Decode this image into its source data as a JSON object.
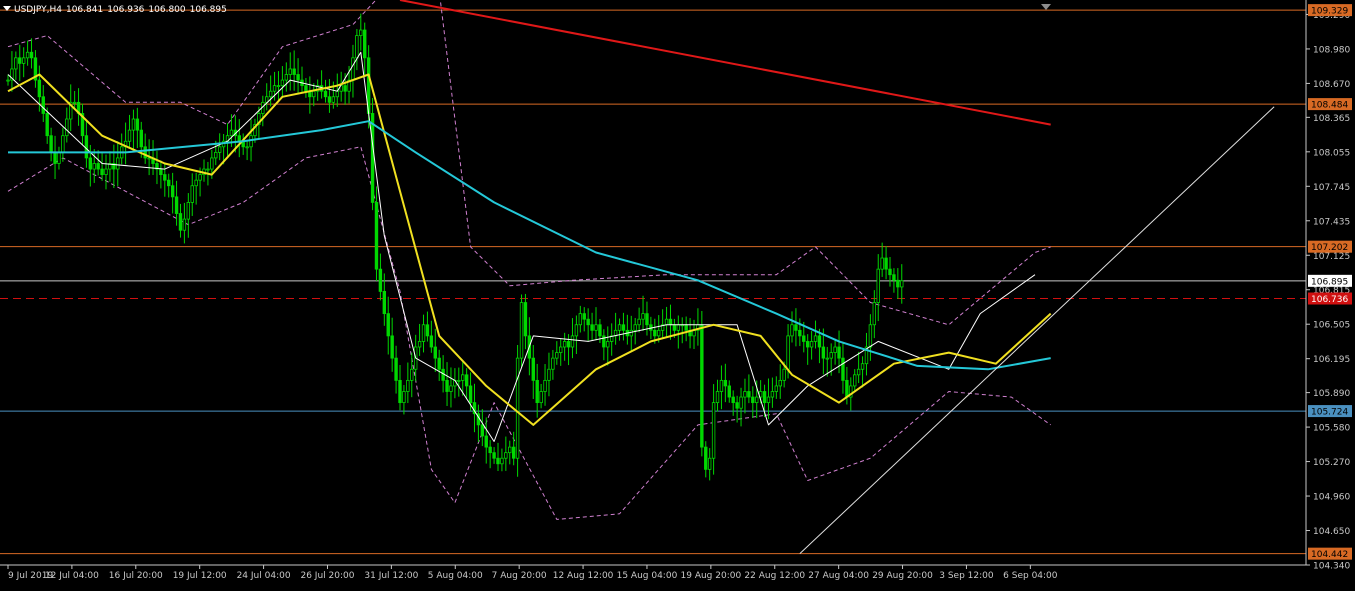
{
  "header": {
    "symbol": "USDJPY,H4",
    "open": "106.841",
    "high": "106.936",
    "low": "106.800",
    "close": "106.895"
  },
  "colors": {
    "background": "#000000",
    "bull_bar": "#00d800",
    "bear_bar": "#00d800",
    "axis": "#c8c8c8",
    "text": "#ffffff",
    "ma_fast": "#ffffff",
    "ma_mid": "#f0e020",
    "ma_slow": "#24c8d8",
    "ma_long": "#e01818",
    "envelope": "#d080d0",
    "level_line": "#d86a24",
    "support_line": "#4a90c0",
    "trendline": "#e0e0e0",
    "ask_line": "#c8c8c8",
    "bid_dash": "#d01010"
  },
  "chart_data": {
    "type": "candlestick",
    "title": "USDJPY,H4",
    "ylim": [
      104.34,
      109.42
    ],
    "y_ticks": [
      "109.290",
      "108.980",
      "108.670",
      "108.365",
      "108.055",
      "107.745",
      "107.435",
      "107.125",
      "106.815",
      "106.505",
      "106.195",
      "105.890",
      "105.580",
      "105.270",
      "104.960",
      "104.650",
      "104.340"
    ],
    "x_ticks": [
      "9 Jul 2019",
      "12 Jul 04:00",
      "16 Jul 20:00",
      "19 Jul 12:00",
      "24 Jul 04:00",
      "26 Jul 20:00",
      "31 Jul 12:00",
      "5 Aug 04:00",
      "7 Aug 20:00",
      "12 Aug 12:00",
      "15 Aug 04:00",
      "19 Aug 20:00",
      "22 Aug 12:00",
      "27 Aug 04:00",
      "29 Aug 20:00",
      "3 Sep 12:00",
      "6 Sep 04:00"
    ],
    "last_price": 106.895,
    "price_labels": [
      {
        "value": 109.329,
        "label": "109.329",
        "kind": "level"
      },
      {
        "value": 108.484,
        "label": "108.484",
        "kind": "level"
      },
      {
        "value": 107.202,
        "label": "107.202",
        "kind": "level"
      },
      {
        "value": 106.895,
        "label": "106.895",
        "kind": "current"
      },
      {
        "value": 106.736,
        "label": "106.736",
        "kind": "bid"
      },
      {
        "value": 105.724,
        "label": "105.724",
        "kind": "support"
      },
      {
        "value": 104.442,
        "label": "104.442",
        "kind": "level"
      }
    ],
    "horizontal_lines": [
      {
        "value": 109.329,
        "kind": "level"
      },
      {
        "value": 108.484,
        "kind": "level"
      },
      {
        "value": 107.202,
        "kind": "level"
      },
      {
        "value": 106.895,
        "kind": "current"
      },
      {
        "value": 106.736,
        "kind": "bid"
      },
      {
        "value": 105.724,
        "kind": "support"
      },
      {
        "value": 104.442,
        "kind": "level"
      }
    ],
    "trendline": {
      "from": {
        "bar": 202,
        "price": 104.442
      },
      "to": {
        "bar": 323,
        "price": 108.46
      }
    },
    "candles": {
      "start_bar": 0,
      "close": [
        108.7,
        108.8,
        108.9,
        108.85,
        108.9,
        108.95,
        108.9,
        108.7,
        108.55,
        108.4,
        108.2,
        108.05,
        107.95,
        108.05,
        108.2,
        108.35,
        108.5,
        108.5,
        108.4,
        108.2,
        108,
        107.9,
        107.95,
        107.9,
        107.85,
        107.9,
        107.95,
        107.9,
        108,
        108.1,
        108.15,
        108.25,
        108.35,
        108.25,
        108.1,
        108,
        108,
        107.95,
        107.9,
        107.85,
        107.8,
        107.75,
        107.65,
        107.5,
        107.35,
        107.45,
        107.6,
        107.75,
        107.8,
        107.85,
        107.9,
        107.9,
        108,
        108.05,
        108.1,
        108.15,
        108.2,
        108.25,
        108.2,
        108.15,
        108.1,
        108.1,
        108.2,
        108.3,
        108.4,
        108.5,
        108.55,
        108.6,
        108.65,
        108.65,
        108.7,
        108.75,
        108.8,
        108.75,
        108.7,
        108.65,
        108.6,
        108.55,
        108.6,
        108.65,
        108.6,
        108.55,
        108.5,
        108.55,
        108.6,
        108.65,
        108.6,
        108.7,
        108.9,
        109.1,
        109.15,
        108.9,
        108.4,
        107.6,
        107,
        106.8,
        106.6,
        106.4,
        106.2,
        106,
        105.8,
        105.9,
        106,
        106.1,
        106.3,
        106.35,
        106.5,
        106.4,
        106.3,
        106.2,
        106.1,
        106,
        105.9,
        105.95,
        106,
        106,
        106.05,
        105.95,
        105.8,
        105.7,
        105.6,
        105.5,
        105.4,
        105.35,
        105.3,
        105.25,
        105.3,
        105.35,
        105.4,
        105.3,
        106.2,
        106.7,
        106.4,
        106.2,
        106,
        105.8,
        105.9,
        106,
        106.1,
        106.2,
        106.25,
        106.3,
        106.35,
        106.3,
        106.4,
        106.5,
        106.6,
        106.55,
        106.5,
        106.45,
        106.5,
        106.4,
        106.3,
        106.35,
        106.4,
        106.45,
        106.5,
        106.45,
        106.4,
        106.45,
        106.5,
        106.55,
        106.6,
        106.5,
        106.45,
        106.4,
        106.45,
        106.5,
        106.55,
        106.5,
        106.45,
        106.5,
        106.5,
        106.45,
        106.4,
        106.45,
        106.5,
        105.4,
        105.2,
        105.3,
        105.8,
        105.9,
        106.0,
        105.95,
        105.85,
        105.8,
        105.75,
        105.85,
        105.9,
        105.85,
        105.8,
        105.85,
        105.9,
        105.8,
        105.85,
        105.9,
        105.95,
        106.0,
        106.1,
        106.4,
        106.5,
        106.45,
        106.4,
        106.35,
        106.3,
        106.35,
        106.4,
        106.3,
        106.2,
        106.2,
        106.25,
        106.3,
        106.2,
        106.0,
        105.85,
        105.95,
        106.05,
        106.1,
        106.15,
        106.3,
        106.5,
        106.7,
        107.0,
        107.1,
        107.0,
        106.95,
        106.9,
        106.84,
        106.895
      ]
    },
    "series": [
      {
        "name": "",
        "kind": "ma_fast",
        "points": [
          [
            0,
            108.75
          ],
          [
            24,
            107.95
          ],
          [
            40,
            107.9
          ],
          [
            56,
            108.15
          ],
          [
            72,
            108.7
          ],
          [
            84,
            108.6
          ],
          [
            90,
            108.95
          ],
          [
            96,
            107.3
          ],
          [
            104,
            106.2
          ],
          [
            114,
            106.0
          ],
          [
            124,
            105.45
          ],
          [
            134,
            106.4
          ],
          [
            148,
            106.35
          ],
          [
            168,
            106.5
          ],
          [
            186,
            106.5
          ],
          [
            194,
            105.6
          ],
          [
            204,
            105.95
          ],
          [
            222,
            106.35
          ],
          [
            240,
            106.1
          ],
          [
            248,
            106.6
          ],
          [
            262,
            106.95
          ]
        ]
      },
      {
        "name": "",
        "kind": "ma_mid",
        "points": [
          [
            0,
            108.6
          ],
          [
            8,
            108.75
          ],
          [
            24,
            108.2
          ],
          [
            40,
            107.95
          ],
          [
            52,
            107.85
          ],
          [
            70,
            108.55
          ],
          [
            84,
            108.65
          ],
          [
            92,
            108.75
          ],
          [
            100,
            107.7
          ],
          [
            110,
            106.4
          ],
          [
            122,
            105.95
          ],
          [
            134,
            105.6
          ],
          [
            150,
            106.1
          ],
          [
            164,
            106.35
          ],
          [
            180,
            106.5
          ],
          [
            192,
            106.4
          ],
          [
            200,
            106.05
          ],
          [
            212,
            105.8
          ],
          [
            226,
            106.15
          ],
          [
            240,
            106.25
          ],
          [
            252,
            106.15
          ],
          [
            266,
            106.6
          ]
        ]
      },
      {
        "name": "",
        "kind": "ma_slow",
        "points": [
          [
            0,
            108.05
          ],
          [
            30,
            108.05
          ],
          [
            60,
            108.15
          ],
          [
            80,
            108.25
          ],
          [
            92,
            108.33
          ],
          [
            104,
            108.05
          ],
          [
            124,
            107.6
          ],
          [
            150,
            107.15
          ],
          [
            176,
            106.9
          ],
          [
            196,
            106.6
          ],
          [
            212,
            106.35
          ],
          [
            232,
            106.13
          ],
          [
            250,
            106.1
          ],
          [
            266,
            106.2
          ]
        ]
      },
      {
        "name": "",
        "kind": "ma_long",
        "points": [
          [
            100,
            109.42
          ],
          [
            266,
            108.3
          ]
        ]
      },
      {
        "name": "",
        "kind": "env_upper",
        "points": [
          [
            0,
            109.0
          ],
          [
            10,
            109.1
          ],
          [
            30,
            108.5
          ],
          [
            44,
            108.5
          ],
          [
            56,
            108.3
          ],
          [
            70,
            109.0
          ],
          [
            88,
            109.2
          ],
          [
            96,
            109.5
          ],
          [
            110,
            109.5
          ],
          [
            118,
            107.2
          ],
          [
            128,
            106.85
          ],
          [
            144,
            106.9
          ],
          [
            168,
            106.95
          ],
          [
            196,
            106.95
          ],
          [
            206,
            107.2
          ],
          [
            220,
            106.7
          ],
          [
            240,
            106.5
          ],
          [
            262,
            107.15
          ],
          [
            266,
            107.2
          ]
        ]
      },
      {
        "name": "",
        "kind": "env_lower",
        "points": [
          [
            0,
            107.7
          ],
          [
            14,
            108.0
          ],
          [
            30,
            107.7
          ],
          [
            46,
            107.4
          ],
          [
            60,
            107.6
          ],
          [
            76,
            108.0
          ],
          [
            90,
            108.1
          ],
          [
            100,
            106.8
          ],
          [
            108,
            105.2
          ],
          [
            114,
            104.9
          ],
          [
            124,
            105.8
          ],
          [
            140,
            104.75
          ],
          [
            156,
            104.8
          ],
          [
            176,
            105.6
          ],
          [
            196,
            105.7
          ],
          [
            204,
            105.1
          ],
          [
            220,
            105.3
          ],
          [
            240,
            105.9
          ],
          [
            256,
            105.85
          ],
          [
            266,
            105.6
          ]
        ]
      }
    ]
  }
}
